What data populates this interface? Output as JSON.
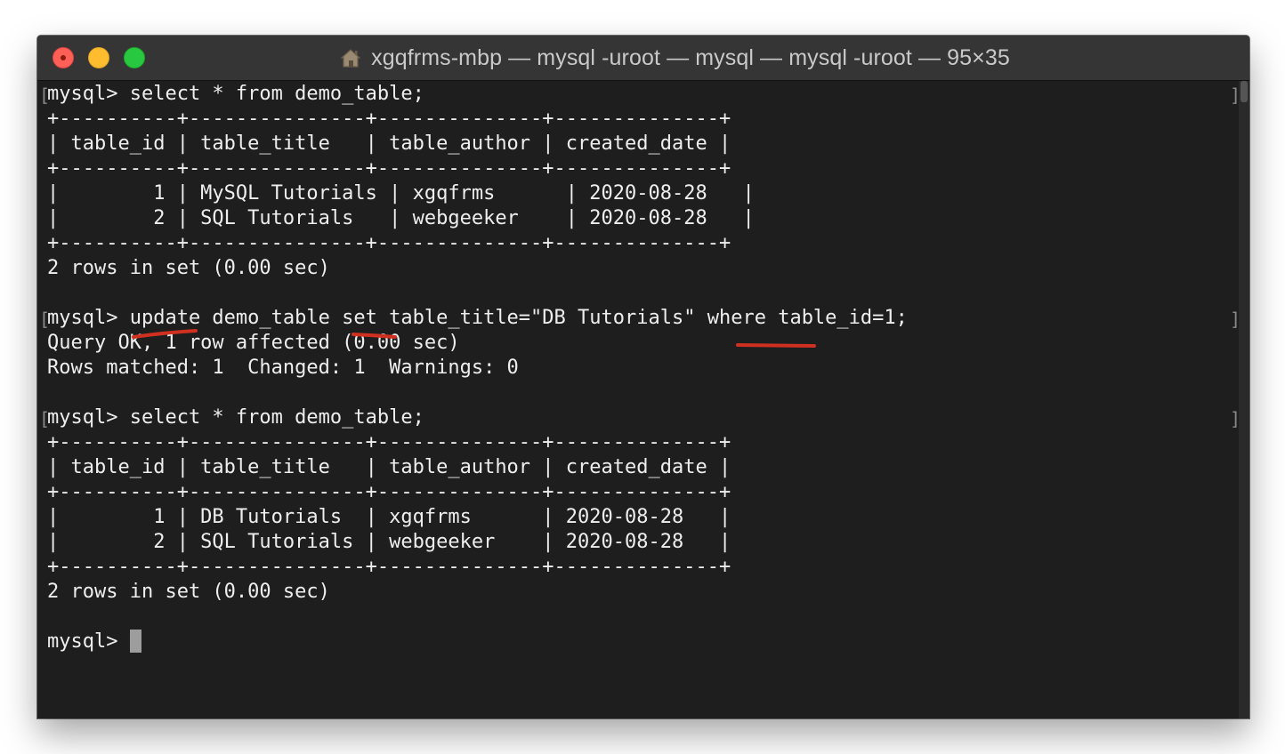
{
  "window": {
    "title": "xgqfrms-mbp — mysql -uroot — mysql — mysql -uroot — 95×35"
  },
  "colors": {
    "terminal_bg": "#1e1e1e",
    "text": "#eeeeee",
    "annotation": "#d0301f"
  },
  "icons": {
    "close": "close-icon",
    "minimize": "minimize-icon",
    "zoom": "zoom-icon",
    "title": "home-icon"
  },
  "terminal": {
    "lines": [
      "mysql> select * from demo_table;",
      "+----------+---------------+--------------+--------------+",
      "| table_id | table_title   | table_author | created_date |",
      "+----------+---------------+--------------+--------------+",
      "|        1 | MySQL Tutorials | xgqfrms      | 2020-08-28   |",
      "|        2 | SQL Tutorials   | webgeeker    | 2020-08-28   |",
      "+----------+---------------+--------------+--------------+",
      "2 rows in set (0.00 sec)",
      "",
      "mysql> update demo_table set table_title=\"DB Tutorials\" where table_id=1;",
      "Query OK, 1 row affected (0.00 sec)",
      "Rows matched: 1  Changed: 1  Warnings: 0",
      "",
      "mysql> select * from demo_table;",
      "+----------+---------------+--------------+--------------+",
      "| table_id | table_title   | table_author | created_date |",
      "+----------+---------------+--------------+--------------+",
      "|        1 | DB Tutorials  | xgqfrms      | 2020-08-28   |",
      "|        2 | SQL Tutorials | webgeeker    | 2020-08-28   |",
      "+----------+---------------+--------------+--------------+",
      "2 rows in set (0.00 sec)",
      "",
      "mysql> "
    ]
  }
}
